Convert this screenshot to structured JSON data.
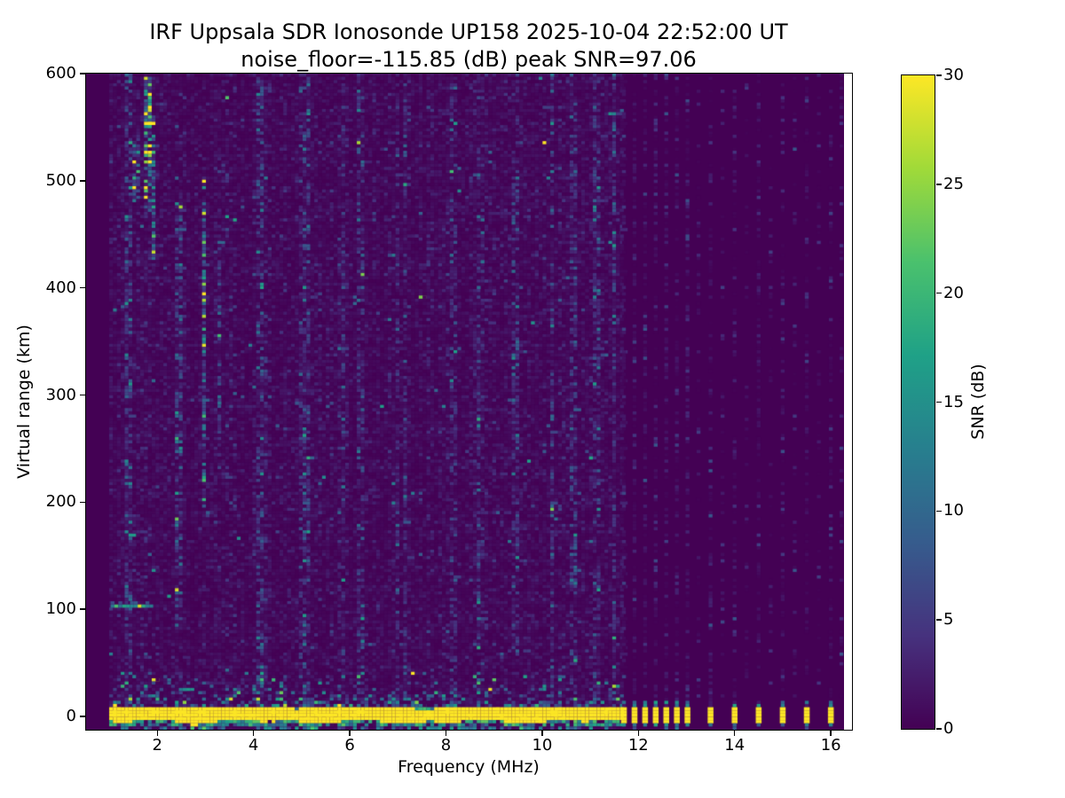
{
  "chart_data": {
    "type": "heatmap",
    "title": "IRF Uppsala SDR Ionosonde UP158 2025-10-04 22:52:00  UT",
    "subtitle": "noise_floor=-115.85 (dB) peak SNR=97.06",
    "xlabel": "Frequency (MHz)",
    "ylabel": "Virtual range (km)",
    "xlim": [
      0.52,
      16.44
    ],
    "ylim": [
      -12.4,
      600
    ],
    "xticks": [
      2,
      4,
      6,
      8,
      10,
      12,
      14,
      16
    ],
    "yticks": [
      0,
      100,
      200,
      300,
      400,
      500,
      600
    ],
    "grid": false,
    "noise_floor_db": -115.85,
    "peak_snr_db": 97.06,
    "colorbar": {
      "label": "SNR (dB)",
      "range": [
        0,
        30
      ],
      "ticks": [
        0,
        5,
        10,
        15,
        20,
        25,
        30
      ],
      "colormap": "viridis",
      "stops": [
        "#440154",
        "#46327e",
        "#365c8d",
        "#277f8e",
        "#1fa187",
        "#4ac16d",
        "#a0da39",
        "#fde725"
      ]
    },
    "background_color": "#440154",
    "signal": {
      "seed": 20251004,
      "noise_mean_db": 0.85,
      "sweep_range_mhz": [
        1.0,
        11.64
      ],
      "ground_echo_band": {
        "km_center": 2.2,
        "km_halfwidth": 6.8,
        "snr_db": 30
      },
      "echo_line": {
        "km": 103,
        "mhz": [
          1.03,
          1.85
        ],
        "snr_db": 18
      },
      "discrete_channels_mhz": [
        11.7,
        11.92,
        12.14,
        12.36,
        12.58,
        12.8,
        13.02,
        13.5,
        14.0,
        14.5,
        15.0,
        15.5,
        16.0
      ],
      "weak_channels_mhz": [
        13.25,
        13.75,
        14.25,
        14.75,
        15.25,
        15.75,
        16.22
      ],
      "strong_interference": [
        {
          "mhz": 1.78,
          "km": [
            470,
            598
          ],
          "boost": 9
        },
        {
          "mhz": 1.9,
          "km": [
            420,
            560
          ],
          "boost": 6
        },
        {
          "mhz": 1.53,
          "km": [
            480,
            540
          ],
          "boost": 5
        },
        {
          "mhz": 2.94,
          "km": [
            195,
            505
          ],
          "boost": 7
        },
        {
          "mhz": 2.42,
          "km": [
            80,
            480
          ],
          "boost": 3
        },
        {
          "mhz": 3.25,
          "km": [
            230,
            460
          ],
          "boost": 2.6
        },
        {
          "mhz": 1.35,
          "km": [
            0,
            600
          ],
          "boost": 2.4
        },
        {
          "mhz": 4.05,
          "km": [
            0,
            600
          ],
          "boost": 2.0
        },
        {
          "mhz": 5.05,
          "km": [
            0,
            600
          ],
          "boost": 2.1
        },
        {
          "mhz": 6.2,
          "km": [
            0,
            600
          ],
          "boost": 1.9
        },
        {
          "mhz": 7.1,
          "km": [
            0,
            600
          ],
          "boost": 2.0
        },
        {
          "mhz": 8.1,
          "km": [
            0,
            600
          ],
          "boost": 1.9
        },
        {
          "mhz": 8.65,
          "km": [
            0,
            600
          ],
          "boost": 2.1
        },
        {
          "mhz": 9.4,
          "km": [
            60,
            520
          ],
          "boost": 2.0
        },
        {
          "mhz": 10.15,
          "km": [
            0,
            600
          ],
          "boost": 2.1
        },
        {
          "mhz": 10.6,
          "km": [
            0,
            600
          ],
          "boost": 1.9
        },
        {
          "mhz": 11.1,
          "km": [
            0,
            600
          ],
          "boost": 2.1
        }
      ]
    }
  }
}
